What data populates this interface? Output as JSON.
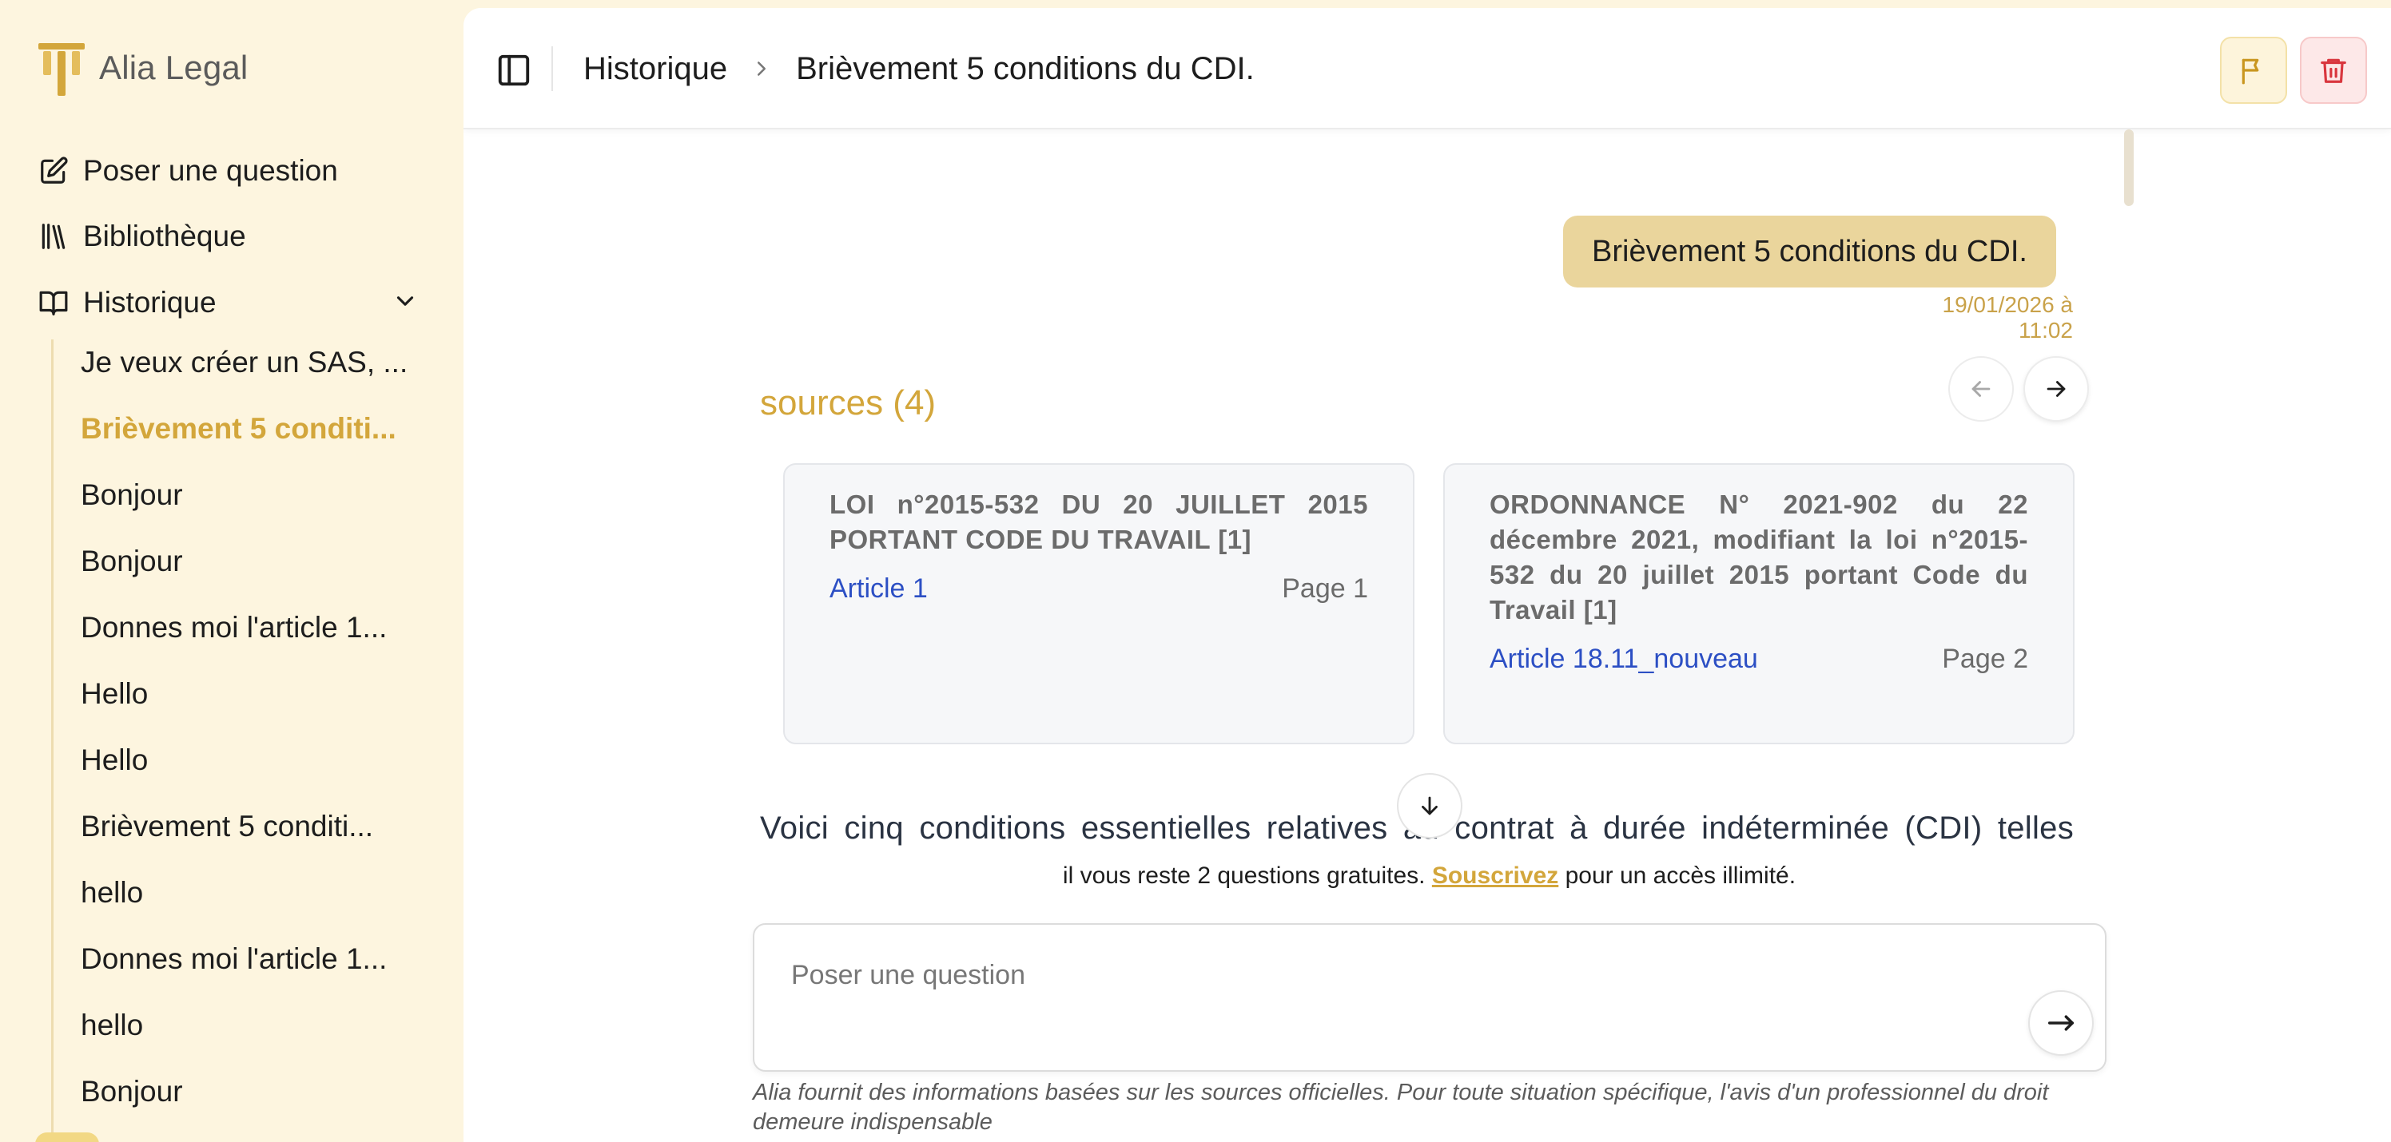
{
  "app": {
    "name": "Alia Legal",
    "accent_color": "#d3a63b",
    "sidebar_bg": "#fdf5df"
  },
  "sidebar": {
    "nav": {
      "ask": {
        "label": "Poser une question",
        "icon": "pencil-square-icon"
      },
      "library": {
        "label": "Bibliothèque",
        "icon": "library-icon"
      },
      "history": {
        "label": "Historique",
        "icon": "book-open-icon",
        "expanded": true
      }
    },
    "history_items": [
      {
        "label": "Je veux créer un SAS, ...",
        "active": false
      },
      {
        "label": "Brièvement 5 conditi...",
        "active": true
      },
      {
        "label": "Bonjour",
        "active": false
      },
      {
        "label": "Bonjour",
        "active": false
      },
      {
        "label": "Donnes moi l'article 1...",
        "active": false
      },
      {
        "label": "Hello",
        "active": false
      },
      {
        "label": "Hello",
        "active": false
      },
      {
        "label": "Brièvement 5 conditi...",
        "active": false
      },
      {
        "label": "hello",
        "active": false
      },
      {
        "label": "Donnes moi l'article 1...",
        "active": false
      },
      {
        "label": "hello",
        "active": false
      },
      {
        "label": "Bonjour",
        "active": false
      }
    ]
  },
  "header": {
    "breadcrumb_root": "Historique",
    "breadcrumb_current": "Brièvement 5 conditions du CDI.",
    "flag_icon": "flag-icon",
    "trash_icon": "trash-icon"
  },
  "chat": {
    "user_message": "Brièvement 5 conditions du CDI.",
    "timestamp": "19/01/2026 à 11:02",
    "sources_title": "sources (4)",
    "sources": [
      {
        "title": "LOI n°2015-532 DU 20 JUILLET 2015 PORTANT CODE DU TRAVAIL [1]",
        "article": "Article 1",
        "page": "Page 1"
      },
      {
        "title": "ORDONNANCE N° 2021-902 du 22 décembre 2021, modifiant la loi n°2015-532 du 20 juillet 2015 portant Code du Travail [1]",
        "article": "Article 18.11_nouveau",
        "page": "Page 2"
      }
    ],
    "answer_preview": "Voici cinq conditions essentielles relatives au contrat à durée indéterminée (CDI) telles"
  },
  "quota": {
    "prefix": "il vous reste 2 questions gratuites. ",
    "link": "Souscrivez",
    "suffix": " pour un accès illimité."
  },
  "composer": {
    "placeholder": "Poser une question",
    "value": ""
  },
  "disclaimer": "Alia fournit des informations basées sur les sources officielles. Pour toute situation spécifique, l'avis d'un professionnel du droit demeure indispensable"
}
